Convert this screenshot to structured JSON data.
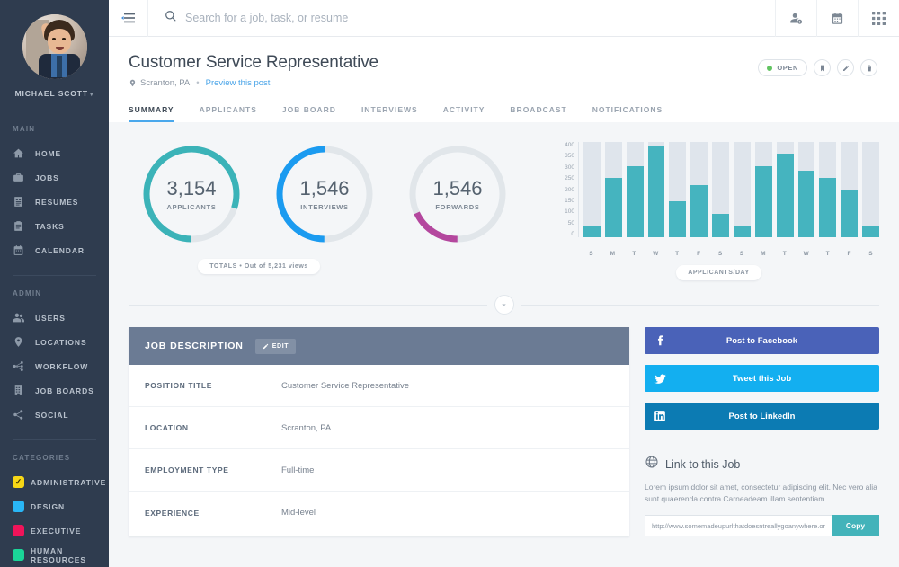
{
  "sidebar": {
    "user": {
      "name": "MICHAEL SCOTT",
      "caret": "▾"
    },
    "sections": [
      {
        "label": "MAIN",
        "items": [
          {
            "label": "HOME",
            "icon": "home-icon"
          },
          {
            "label": "JOBS",
            "icon": "briefcase-icon"
          },
          {
            "label": "RESUMES",
            "icon": "resume-icon"
          },
          {
            "label": "TASKS",
            "icon": "clipboard-icon"
          },
          {
            "label": "CALENDAR",
            "icon": "calendar-icon"
          }
        ]
      },
      {
        "label": "ADMIN",
        "items": [
          {
            "label": "USERS",
            "icon": "users-icon"
          },
          {
            "label": "LOCATIONS",
            "icon": "map-pin-icon"
          },
          {
            "label": "WORKFLOW",
            "icon": "workflow-icon"
          },
          {
            "label": "JOB BOARDS",
            "icon": "building-icon"
          },
          {
            "label": "SOCIAL",
            "icon": "share-icon"
          }
        ]
      }
    ],
    "categories": {
      "label": "CATEGORIES",
      "items": [
        {
          "label": "ADMINISTRATIVE",
          "color": "#f7d716",
          "checked": true
        },
        {
          "label": "DESIGN",
          "color": "#29b6f6",
          "checked": false
        },
        {
          "label": "EXECUTIVE",
          "color": "#f0145a",
          "checked": false
        },
        {
          "label": "HUMAN RESOURCES",
          "color": "#1ad598",
          "checked": false
        }
      ]
    }
  },
  "topbar": {
    "menu_icon": "hamburger-icon",
    "search": {
      "placeholder": "Search for a job, task, or resume",
      "value": ""
    },
    "actions": [
      {
        "name": "add-user-icon"
      },
      {
        "name": "calendar-icon"
      },
      {
        "name": "apps-grid-icon"
      }
    ]
  },
  "page": {
    "title": "Customer Service Representative",
    "location": "Scranton, PA",
    "separator": "•",
    "preview_link": "Preview this post",
    "status": {
      "label": "OPEN",
      "color": "#62c462"
    },
    "actions": [
      {
        "name": "bookmark-button"
      },
      {
        "name": "edit-button"
      },
      {
        "name": "delete-button"
      }
    ]
  },
  "tabs": [
    {
      "label": "SUMMARY",
      "active": true
    },
    {
      "label": "APPLICANTS",
      "active": false
    },
    {
      "label": "JOB BOARD",
      "active": false
    },
    {
      "label": "INTERVIEWS",
      "active": false
    },
    {
      "label": "ACTIVITY",
      "active": false
    },
    {
      "label": "BROADCAST",
      "active": false
    },
    {
      "label": "NOTIFICATIONS",
      "active": false
    }
  ],
  "stats": {
    "donuts": [
      {
        "value": "3,154",
        "label": "APPLICANTS",
        "percent": 80,
        "color": "#3bb3b8",
        "start": 180
      },
      {
        "value": "1,546",
        "label": "INTERVIEWS",
        "percent": 50,
        "color": "#1b9bf0",
        "start": 180
      },
      {
        "value": "1,546",
        "label": "FORWARDS",
        "percent": 18,
        "color": "#b4479e",
        "start": 180
      }
    ],
    "totals_chip": "TOTALS • Out of 5,231 views",
    "chart_chip": "APPLICANTS/DAY"
  },
  "chart_data": {
    "type": "bar",
    "title": "APPLICANTS/DAY",
    "categories": [
      "S",
      "M",
      "T",
      "W",
      "T",
      "F",
      "S",
      "S",
      "M",
      "T",
      "W",
      "T",
      "F",
      "S"
    ],
    "values": [
      50,
      250,
      300,
      380,
      150,
      220,
      100,
      50,
      300,
      350,
      280,
      250,
      200,
      50
    ],
    "yticks": [
      400,
      350,
      300,
      250,
      200,
      150,
      100,
      50,
      0
    ],
    "ylim": [
      0,
      400
    ],
    "xlabel": "",
    "ylabel": "",
    "series_color": "#45b4bf",
    "track_color": "#dfe5ec",
    "grid": false,
    "legend": "none"
  },
  "collapse": {
    "icon": "chevron-down-icon"
  },
  "job_description": {
    "heading": "JOB DESCRIPTION",
    "edit_label": "EDIT",
    "rows": [
      {
        "label": "POSITION TITLE",
        "value": "Customer Service Representative"
      },
      {
        "label": "LOCATION",
        "value": "Scranton, PA"
      },
      {
        "label": "EMPLOYMENT TYPE",
        "value": "Full-time"
      },
      {
        "label": "EXPERIENCE",
        "value": "Mid-level"
      }
    ]
  },
  "social": {
    "buttons": [
      {
        "label": "Post to Facebook",
        "icon": "facebook-icon",
        "color": "#4a62b8"
      },
      {
        "label": "Tweet this Job",
        "icon": "twitter-icon",
        "color": "#13aff0"
      },
      {
        "label": "Post to LinkedIn",
        "icon": "linkedin-icon",
        "color": "#0c7bb3"
      }
    ]
  },
  "link_card": {
    "icon": "globe-icon",
    "title": "Link to this Job",
    "description": "Lorem ipsum dolor sit amet, consectetur adipiscing elit. Nec vero alia sunt quaerenda contra Carneadeam illam sententiam.",
    "url": "http://www.somemadeupurlthatdoesntreallygoanywhere.org",
    "copy_label": "Copy"
  }
}
